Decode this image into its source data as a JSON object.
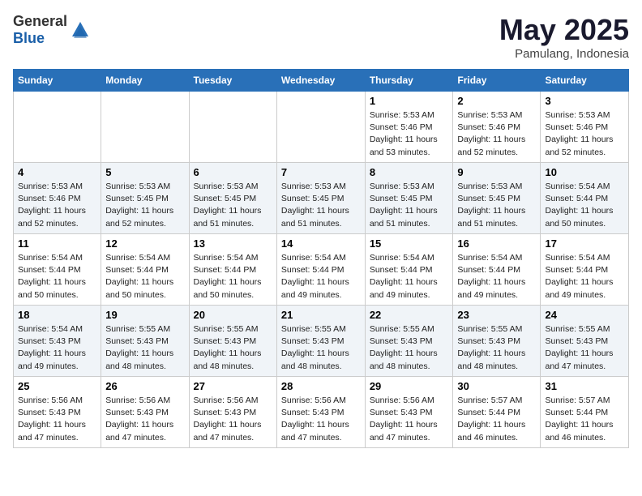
{
  "header": {
    "logo_general": "General",
    "logo_blue": "Blue",
    "month_title": "May 2025",
    "location": "Pamulang, Indonesia"
  },
  "weekdays": [
    "Sunday",
    "Monday",
    "Tuesday",
    "Wednesday",
    "Thursday",
    "Friday",
    "Saturday"
  ],
  "weeks": [
    [
      {
        "day": "",
        "info": ""
      },
      {
        "day": "",
        "info": ""
      },
      {
        "day": "",
        "info": ""
      },
      {
        "day": "",
        "info": ""
      },
      {
        "day": "1",
        "info": "Sunrise: 5:53 AM\nSunset: 5:46 PM\nDaylight: 11 hours\nand 53 minutes."
      },
      {
        "day": "2",
        "info": "Sunrise: 5:53 AM\nSunset: 5:46 PM\nDaylight: 11 hours\nand 52 minutes."
      },
      {
        "day": "3",
        "info": "Sunrise: 5:53 AM\nSunset: 5:46 PM\nDaylight: 11 hours\nand 52 minutes."
      }
    ],
    [
      {
        "day": "4",
        "info": "Sunrise: 5:53 AM\nSunset: 5:46 PM\nDaylight: 11 hours\nand 52 minutes."
      },
      {
        "day": "5",
        "info": "Sunrise: 5:53 AM\nSunset: 5:45 PM\nDaylight: 11 hours\nand 52 minutes."
      },
      {
        "day": "6",
        "info": "Sunrise: 5:53 AM\nSunset: 5:45 PM\nDaylight: 11 hours\nand 51 minutes."
      },
      {
        "day": "7",
        "info": "Sunrise: 5:53 AM\nSunset: 5:45 PM\nDaylight: 11 hours\nand 51 minutes."
      },
      {
        "day": "8",
        "info": "Sunrise: 5:53 AM\nSunset: 5:45 PM\nDaylight: 11 hours\nand 51 minutes."
      },
      {
        "day": "9",
        "info": "Sunrise: 5:53 AM\nSunset: 5:45 PM\nDaylight: 11 hours\nand 51 minutes."
      },
      {
        "day": "10",
        "info": "Sunrise: 5:54 AM\nSunset: 5:44 PM\nDaylight: 11 hours\nand 50 minutes."
      }
    ],
    [
      {
        "day": "11",
        "info": "Sunrise: 5:54 AM\nSunset: 5:44 PM\nDaylight: 11 hours\nand 50 minutes."
      },
      {
        "day": "12",
        "info": "Sunrise: 5:54 AM\nSunset: 5:44 PM\nDaylight: 11 hours\nand 50 minutes."
      },
      {
        "day": "13",
        "info": "Sunrise: 5:54 AM\nSunset: 5:44 PM\nDaylight: 11 hours\nand 50 minutes."
      },
      {
        "day": "14",
        "info": "Sunrise: 5:54 AM\nSunset: 5:44 PM\nDaylight: 11 hours\nand 49 minutes."
      },
      {
        "day": "15",
        "info": "Sunrise: 5:54 AM\nSunset: 5:44 PM\nDaylight: 11 hours\nand 49 minutes."
      },
      {
        "day": "16",
        "info": "Sunrise: 5:54 AM\nSunset: 5:44 PM\nDaylight: 11 hours\nand 49 minutes."
      },
      {
        "day": "17",
        "info": "Sunrise: 5:54 AM\nSunset: 5:44 PM\nDaylight: 11 hours\nand 49 minutes."
      }
    ],
    [
      {
        "day": "18",
        "info": "Sunrise: 5:54 AM\nSunset: 5:43 PM\nDaylight: 11 hours\nand 49 minutes."
      },
      {
        "day": "19",
        "info": "Sunrise: 5:55 AM\nSunset: 5:43 PM\nDaylight: 11 hours\nand 48 minutes."
      },
      {
        "day": "20",
        "info": "Sunrise: 5:55 AM\nSunset: 5:43 PM\nDaylight: 11 hours\nand 48 minutes."
      },
      {
        "day": "21",
        "info": "Sunrise: 5:55 AM\nSunset: 5:43 PM\nDaylight: 11 hours\nand 48 minutes."
      },
      {
        "day": "22",
        "info": "Sunrise: 5:55 AM\nSunset: 5:43 PM\nDaylight: 11 hours\nand 48 minutes."
      },
      {
        "day": "23",
        "info": "Sunrise: 5:55 AM\nSunset: 5:43 PM\nDaylight: 11 hours\nand 48 minutes."
      },
      {
        "day": "24",
        "info": "Sunrise: 5:55 AM\nSunset: 5:43 PM\nDaylight: 11 hours\nand 47 minutes."
      }
    ],
    [
      {
        "day": "25",
        "info": "Sunrise: 5:56 AM\nSunset: 5:43 PM\nDaylight: 11 hours\nand 47 minutes."
      },
      {
        "day": "26",
        "info": "Sunrise: 5:56 AM\nSunset: 5:43 PM\nDaylight: 11 hours\nand 47 minutes."
      },
      {
        "day": "27",
        "info": "Sunrise: 5:56 AM\nSunset: 5:43 PM\nDaylight: 11 hours\nand 47 minutes."
      },
      {
        "day": "28",
        "info": "Sunrise: 5:56 AM\nSunset: 5:43 PM\nDaylight: 11 hours\nand 47 minutes."
      },
      {
        "day": "29",
        "info": "Sunrise: 5:56 AM\nSunset: 5:43 PM\nDaylight: 11 hours\nand 47 minutes."
      },
      {
        "day": "30",
        "info": "Sunrise: 5:57 AM\nSunset: 5:44 PM\nDaylight: 11 hours\nand 46 minutes."
      },
      {
        "day": "31",
        "info": "Sunrise: 5:57 AM\nSunset: 5:44 PM\nDaylight: 11 hours\nand 46 minutes."
      }
    ]
  ]
}
